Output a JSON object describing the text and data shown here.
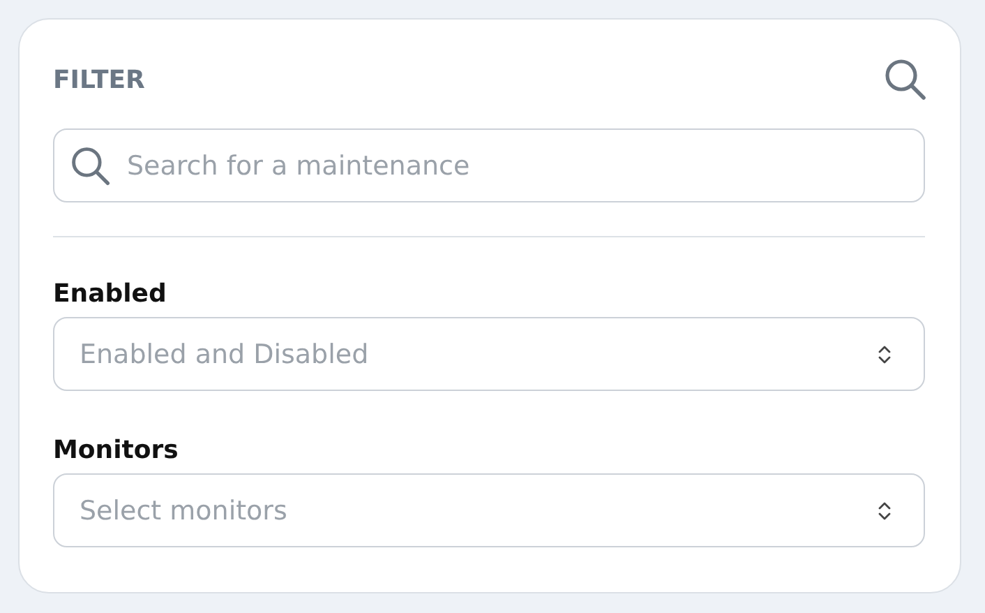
{
  "panel": {
    "title": "FILTER"
  },
  "search": {
    "placeholder": "Search for a maintenance"
  },
  "filters": [
    {
      "label": "Enabled",
      "placeholder": "Enabled and Disabled"
    },
    {
      "label": "Monitors",
      "placeholder": "Select monitors"
    }
  ]
}
